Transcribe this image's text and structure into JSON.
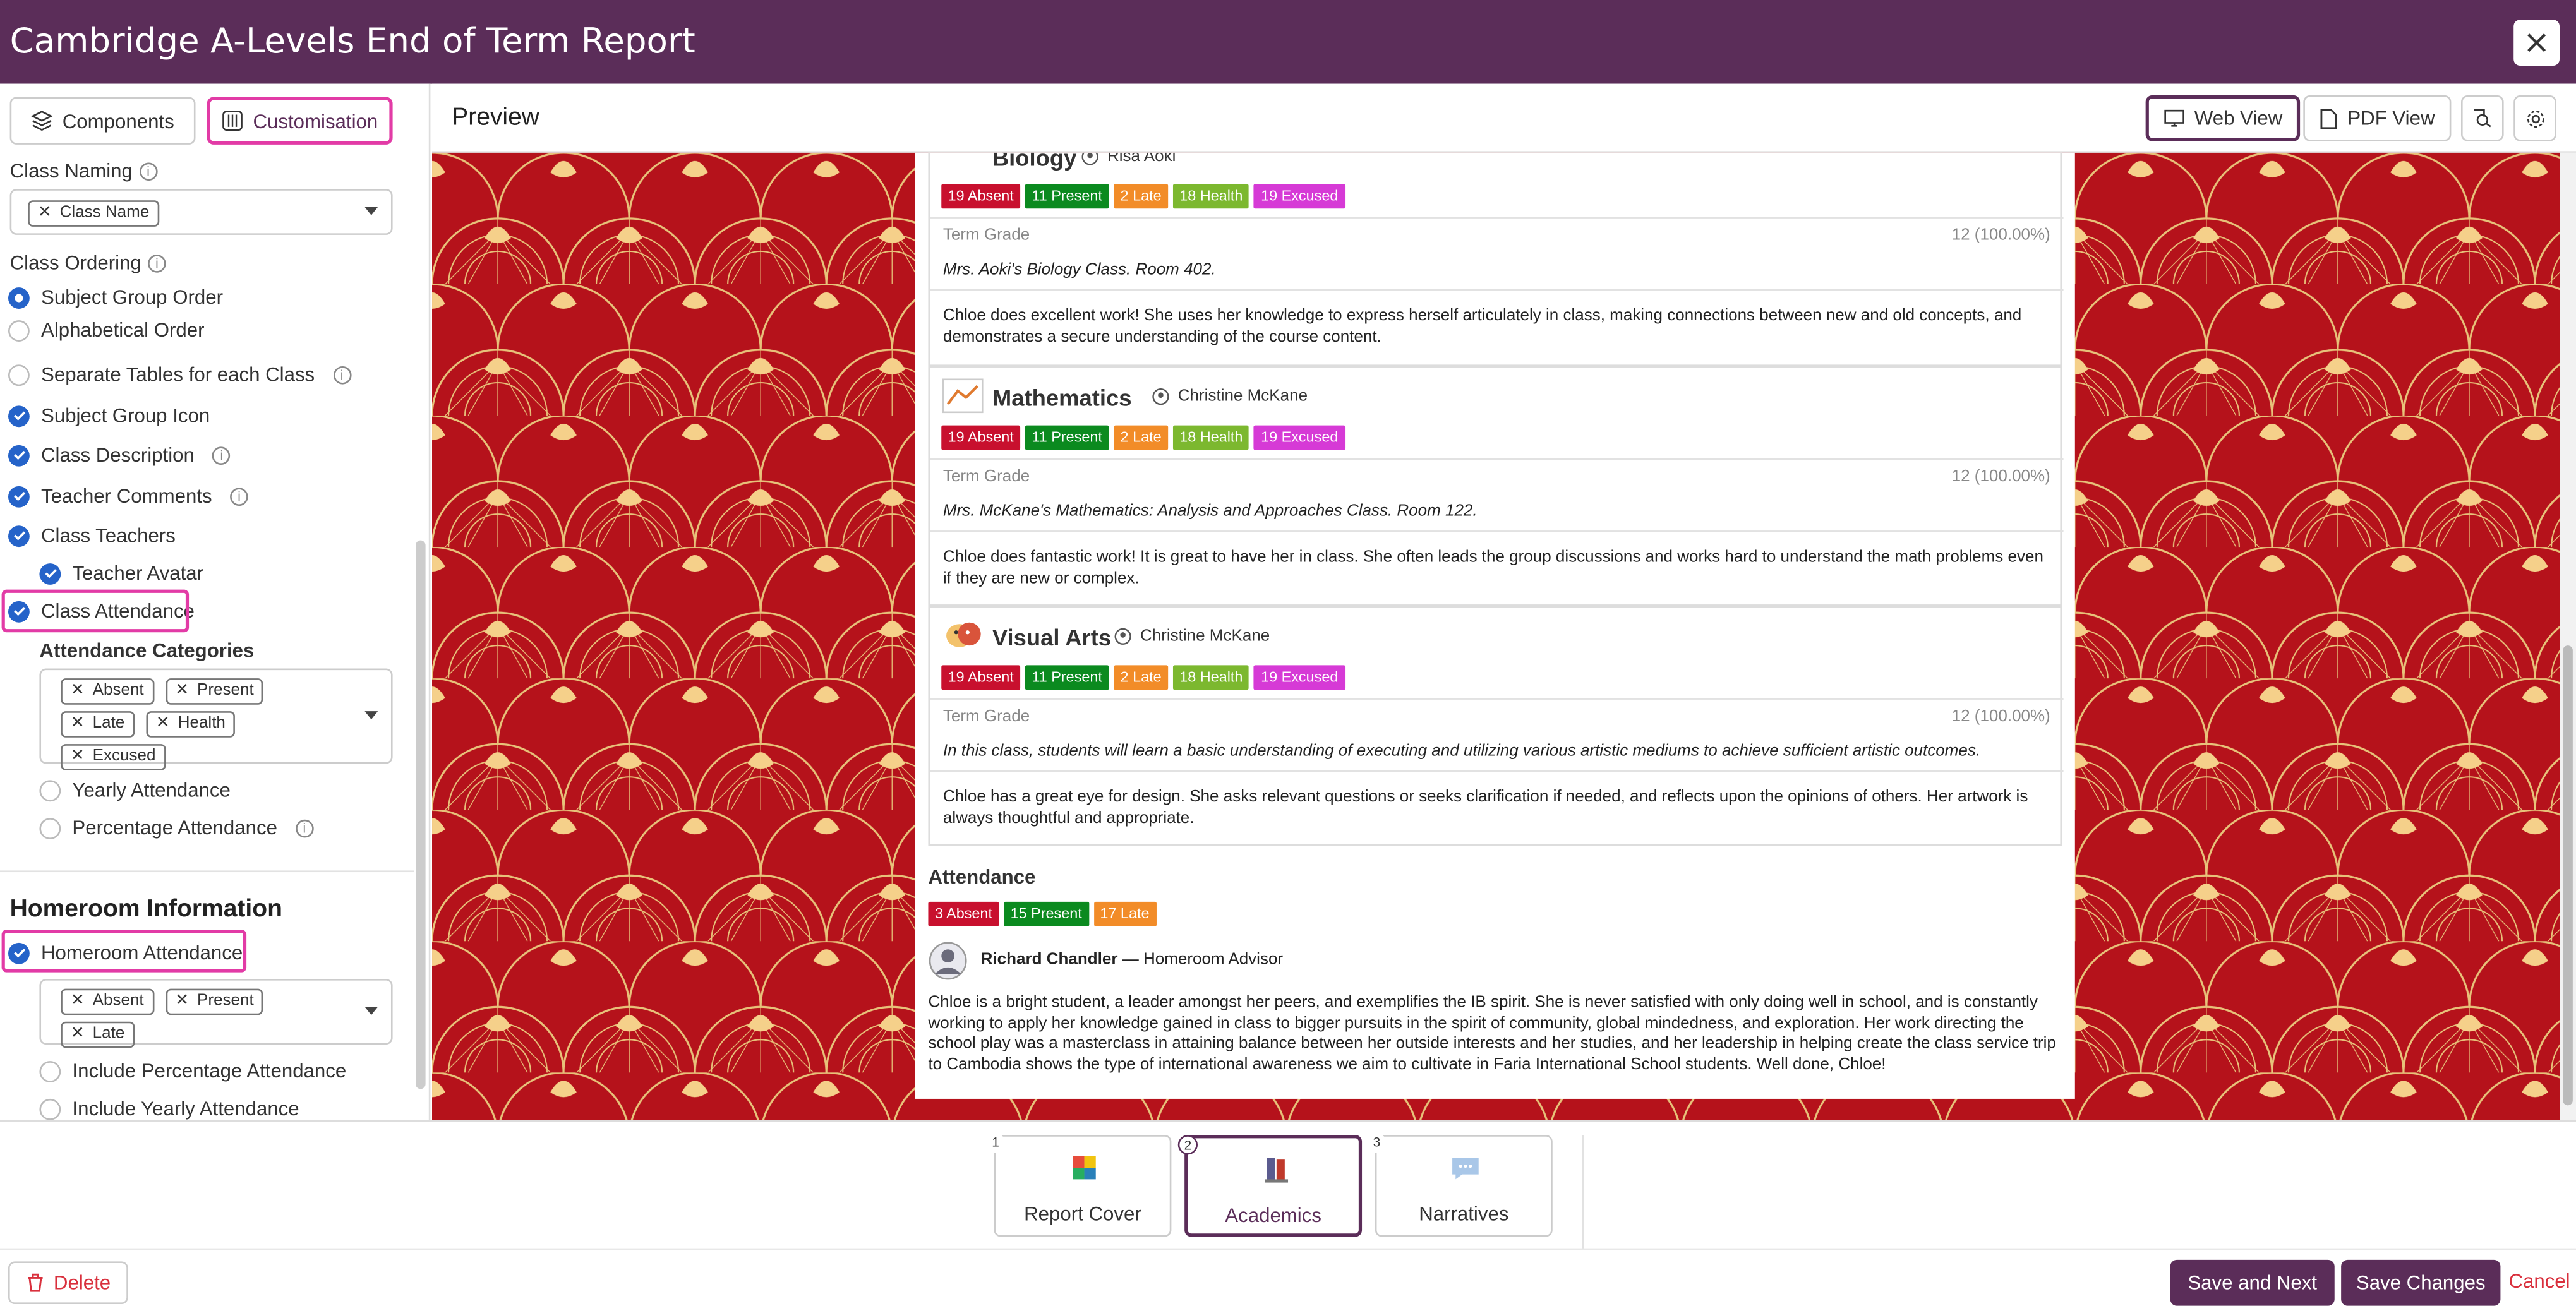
{
  "header": {
    "title": "Cambridge A-Levels End of Term Report"
  },
  "sidebar": {
    "tabs": [
      {
        "label": "Components"
      },
      {
        "label": "Customisation"
      }
    ],
    "class_naming": {
      "label": "Class Naming",
      "chips": [
        "Class Name"
      ]
    },
    "class_ordering": {
      "label": "Class Ordering",
      "options": [
        "Subject Group Order",
        "Alphabetical Order"
      ],
      "selected": "Subject Group Order"
    },
    "options": [
      {
        "label": "Separate Tables for each Class",
        "checked": false
      },
      {
        "label": "Subject Group Icon",
        "checked": true
      },
      {
        "label": "Class Description",
        "checked": true
      },
      {
        "label": "Teacher Comments",
        "checked": true
      },
      {
        "label": "Class Teachers",
        "checked": true
      },
      {
        "label": "Teacher Avatar",
        "checked": true
      },
      {
        "label": "Class Attendance",
        "checked": true
      }
    ],
    "attendance_categories": {
      "label": "Attendance Categories",
      "chips": [
        "Absent",
        "Present",
        "Late",
        "Health",
        "Excused"
      ]
    },
    "attendance_options": [
      {
        "label": "Yearly Attendance",
        "checked": false
      },
      {
        "label": "Percentage Attendance",
        "checked": false
      }
    ],
    "homeroom": {
      "heading": "Homeroom Information",
      "attendance": {
        "label": "Homeroom Attendance",
        "checked": true
      },
      "chips": [
        "Absent",
        "Present",
        "Late"
      ],
      "options": [
        {
          "label": "Include Percentage Attendance",
          "checked": false
        },
        {
          "label": "Include Yearly Attendance",
          "checked": false
        }
      ]
    }
  },
  "preview": {
    "title": "Preview",
    "view_buttons": [
      {
        "label": "Web View"
      },
      {
        "label": "PDF View"
      }
    ],
    "term_grade_label": "Term Grade",
    "classes": [
      {
        "name": "Biology",
        "teacher": "Risa Aoki",
        "badges": [
          "19 Absent",
          "11 Present",
          "2 Late",
          "18 Health",
          "19 Excused"
        ],
        "grade": "12 (100.00%)",
        "description": "Mrs. Aoki's Biology Class. Room 402.",
        "comment": "Chloe does excellent work! She uses her knowledge to express herself articulately in class, making connections between new and old concepts, and demonstrates a secure understanding of the course content."
      },
      {
        "name": "Mathematics",
        "teacher": "Christine McKane",
        "badges": [
          "19 Absent",
          "11 Present",
          "2 Late",
          "18 Health",
          "19 Excused"
        ],
        "grade": "12 (100.00%)",
        "description": "Mrs. McKane's Mathematics: Analysis and Approaches Class. Room 122.",
        "comment": "Chloe does fantastic work! It is great to have her in class. She often leads the group discussions and works hard to understand the math problems even if they are new or complex."
      },
      {
        "name": "Visual Arts",
        "teacher": "Christine McKane",
        "badges": [
          "19 Absent",
          "11 Present",
          "2 Late",
          "18 Health",
          "19 Excused"
        ],
        "grade": "12 (100.00%)",
        "description": "In this class, students will learn a basic understanding of executing and utilizing various artistic mediums to achieve sufficient artistic outcomes.",
        "comment": "Chloe has a great eye for design. She asks relevant questions or seeks clarification if needed, and reflects upon the opinions of others. Her artwork is always thoughtful and appropriate."
      }
    ],
    "attendance": {
      "heading": "Attendance",
      "badges": [
        "3 Absent",
        "15 Present",
        "17 Late"
      ],
      "advisor_name": "Richard Chandler",
      "advisor_role": "— Homeroom Advisor",
      "comment": "Chloe is a bright student, a leader amongst her peers, and exemplifies the IB spirit. She is never satisfied with only doing well in school, and is constantly working to apply her knowledge gained in class to bigger pursuits in the spirit of community, global mindedness, and exploration. Her work directing the school play was a masterclass in attaining balance between her outside interests and her studies, and her leadership in helping create the class service trip to Cambodia shows the type of international awareness we aim to cultivate in Faria International School students. Well done, Chloe!"
    }
  },
  "badge_colors": {
    "absent": "#c8102e",
    "present": "#0b8a1f",
    "late": "#f28c28",
    "health": "#7cb82f",
    "excused": "#d63ad6"
  },
  "steps": [
    {
      "num": "1",
      "label": "Report Cover"
    },
    {
      "num": "2",
      "label": "Academics"
    },
    {
      "num": "3",
      "label": "Narratives"
    }
  ],
  "footer": {
    "delete": "Delete",
    "save_next": "Save and Next",
    "save_changes": "Save Changes",
    "cancel": "Cancel"
  }
}
